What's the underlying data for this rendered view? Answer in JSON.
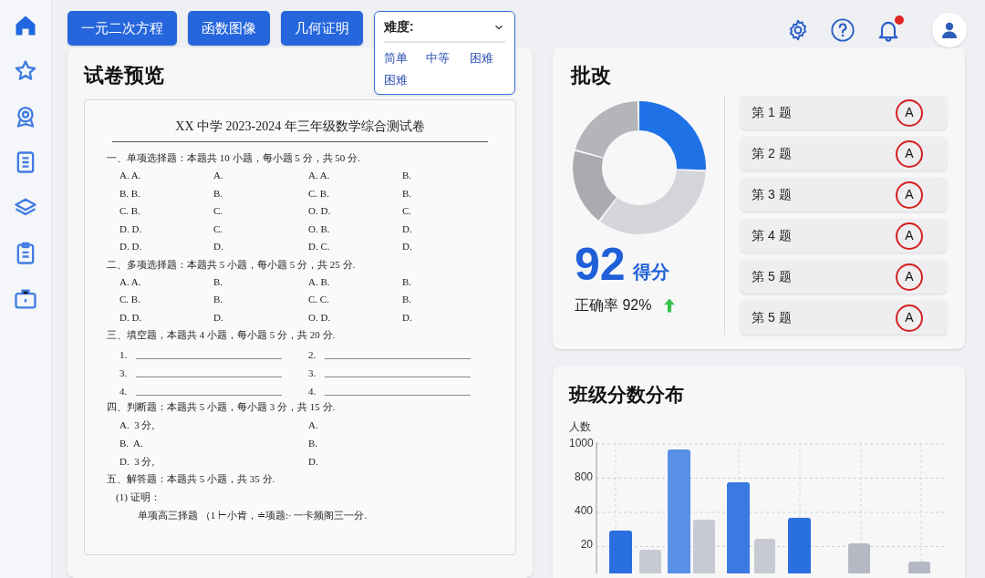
{
  "sidebar": {
    "items": [
      {
        "kind": "home",
        "selected": true
      },
      {
        "kind": "star",
        "selected": false
      },
      {
        "kind": "badge",
        "selected": false
      },
      {
        "kind": "list",
        "selected": false
      },
      {
        "kind": "layers",
        "selected": false
      },
      {
        "kind": "clipboard",
        "selected": false
      },
      {
        "kind": "briefcase",
        "selected": false
      }
    ]
  },
  "toolbar": {
    "buttons": [
      "一元二次方程",
      "函数图像",
      "几何证明"
    ]
  },
  "difficulty_dropdown": {
    "label": "难度:",
    "expanded": true,
    "options": [
      "简单",
      "中等",
      "困难",
      "困难"
    ]
  },
  "header": {
    "notifications_unread": true
  },
  "exam_preview": {
    "title": "试卷预览",
    "paper": {
      "title": "XX 中学 2023-2024 年三年级数学综合测试卷",
      "sections": [
        {
          "kind": "choices",
          "heading": "一、单项选择题：本题共 10 小题，每小题 5 分，共 50 分.",
          "rows": [
            [
              "A. A.",
              "A.",
              "A. A.",
              "B."
            ],
            [
              "B. B.",
              "B.",
              "C. B.",
              "B."
            ],
            [
              "C. B.",
              "C.",
              "O. D.",
              "C."
            ],
            [
              "D. D.",
              "C.",
              "O. B.",
              "D."
            ],
            [
              "D. D.",
              "D.",
              "D. C.",
              "D."
            ]
          ]
        },
        {
          "kind": "choices",
          "heading": "二、多项选择题：本题共 5 小题，每小题 5 分，共 25 分.",
          "rows": [
            [
              "A. A.",
              "B.",
              "A. B.",
              "B."
            ],
            [
              "C. B.",
              "B.",
              "C. C.",
              "B."
            ],
            [
              "D. D.",
              "D.",
              "O. D.",
              "D."
            ]
          ]
        },
        {
          "kind": "blanks",
          "heading": "三、填空题，本题共 4 小题，每小题 5 分，共 20 分.",
          "rows": [
            [
              "1.",
              "2."
            ],
            [
              "3.",
              "3."
            ],
            [
              "4.",
              "4."
            ]
          ]
        },
        {
          "kind": "judgement",
          "heading": "四、判断题：本题共 5 小题，每小题 3 分，共 15 分.",
          "rows": [
            [
              "A.  3 分,",
              "A."
            ],
            [
              "B.  A.",
              "B."
            ],
            [
              "D.  3 分,",
              "D."
            ]
          ]
        },
        {
          "kind": "answer",
          "heading": "五、解答题：本题共 5 小题，共 35 分.",
          "lines": [
            "(1) 证明：",
            "单项高三择题 （1 ⊢小肯，≐项题:· 一卡频阁三一分."
          ]
        }
      ]
    }
  },
  "grading": {
    "title": "批改",
    "score": "92",
    "score_label": "得分",
    "accuracy": "正确率 92%",
    "trend_up": true,
    "questions": [
      {
        "label": "第 1 题",
        "mark": "A"
      },
      {
        "label": "第 2 题",
        "mark": "A"
      },
      {
        "label": "第 3 题",
        "mark": "A"
      },
      {
        "label": "第 4 题",
        "mark": "A"
      },
      {
        "label": "第 5 题",
        "mark": "A"
      },
      {
        "label": "第 5 题",
        "mark": "A"
      }
    ]
  },
  "distribution": {
    "title": "班级分数分布",
    "y_label": "人数",
    "y_tick_labels": [
      "1000",
      "800",
      "400",
      "20"
    ]
  }
}
